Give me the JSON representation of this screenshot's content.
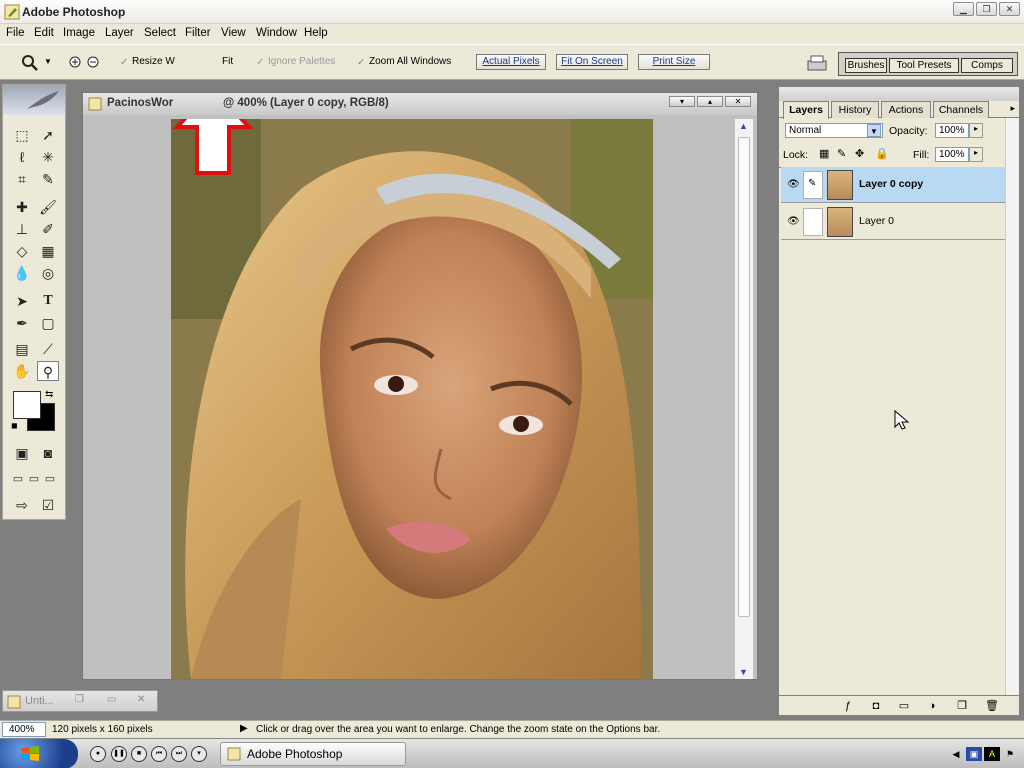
{
  "app": {
    "title": "Adobe Photoshop"
  },
  "menubar": [
    "File",
    "Edit",
    "Image",
    "Layer",
    "Select",
    "Filter",
    "View",
    "Window",
    "Help"
  ],
  "options": {
    "resize_windows_label": "Resize W",
    "fit_fragment": "Fit",
    "ignore_palettes_label": "Ignore Palettes",
    "zoom_all_windows_label": "Zoom All Windows",
    "actual_pixels_label": "Actual Pixels",
    "fit_on_screen_label": "Fit On Screen",
    "print_size_label": "Print Size",
    "palette_well": [
      "Brushes",
      "Tool Presets",
      "Comps"
    ]
  },
  "document": {
    "title_left": "PacinosWor",
    "title_right": "@ 400% (Layer 0 copy, RGB/8)"
  },
  "layers_palette": {
    "tabs": [
      "Layers",
      "History",
      "Actions",
      "Channels"
    ],
    "blend_mode": "Normal",
    "opacity_label": "Opacity:",
    "opacity_value": "100%",
    "lock_label": "Lock:",
    "fill_label": "Fill:",
    "fill_value": "100%",
    "layers": [
      {
        "name": "Layer 0 copy",
        "selected": true
      },
      {
        "name": "Layer 0",
        "selected": false
      }
    ]
  },
  "minimized_window": {
    "title": "Unti..."
  },
  "statusbar": {
    "zoom": "400%",
    "doc_size": "120 pixels x 160 pixels",
    "hint": "Click or drag over the area you want to enlarge. Change the zoom state on the Options bar."
  },
  "taskbar": {
    "task_label": "Adobe Photoshop"
  },
  "colors": {
    "accent_arrow": "#e01010",
    "selected_layer": "#b9d9f3"
  }
}
